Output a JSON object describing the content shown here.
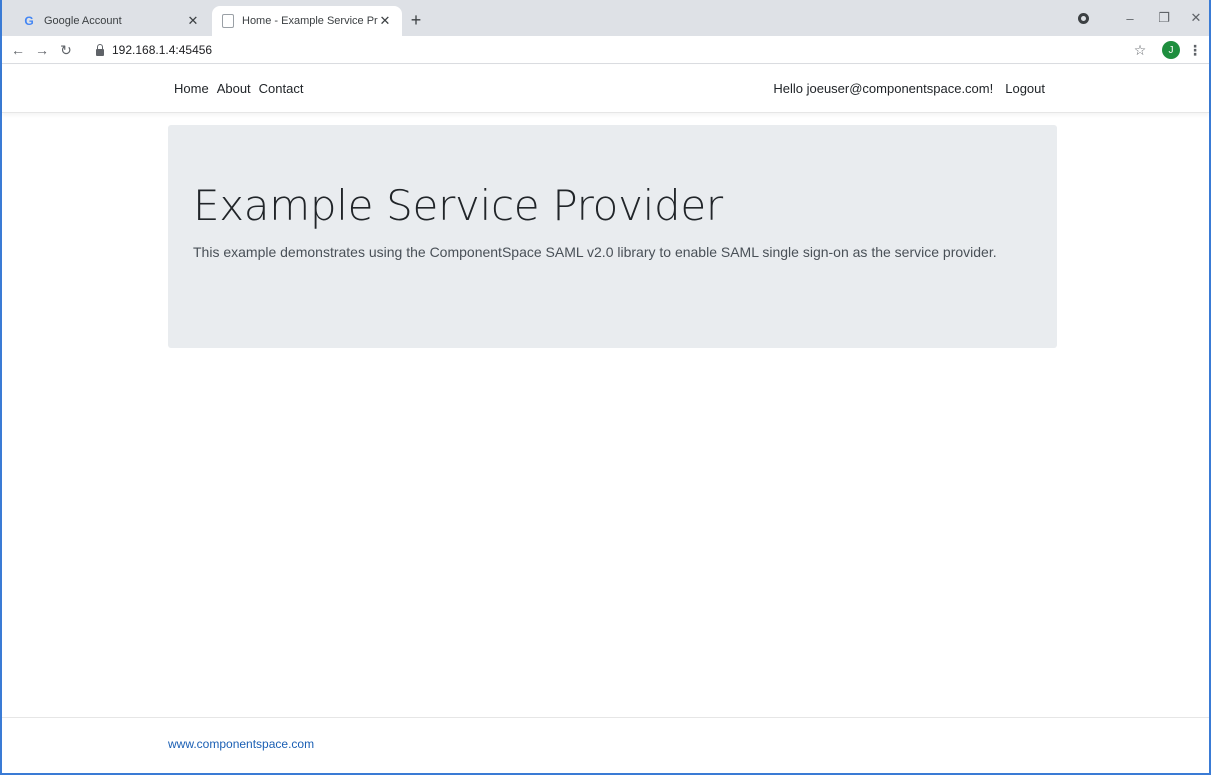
{
  "browser": {
    "tabs": [
      {
        "title": "Google Account",
        "favicon": "google-g-icon",
        "active": false
      },
      {
        "title": "Home - Example Service Provider",
        "favicon": "document-icon",
        "active": true
      }
    ],
    "url": "192.168.1.4:45456",
    "profile_initial": "J",
    "accent_color": "#1e8e3e"
  },
  "site": {
    "nav": {
      "links": [
        "Home",
        "About",
        "Contact"
      ],
      "greeting": "Hello joeuser@componentspace.com!",
      "logout": "Logout"
    },
    "jumbotron": {
      "title": "Example Service Provider",
      "lead": "This example demonstrates using the ComponentSpace SAML v2.0 library to enable SAML single sign-on as the service provider."
    },
    "footer": {
      "link": "www.componentspace.com",
      "link_color": "#1a5fb4"
    }
  }
}
